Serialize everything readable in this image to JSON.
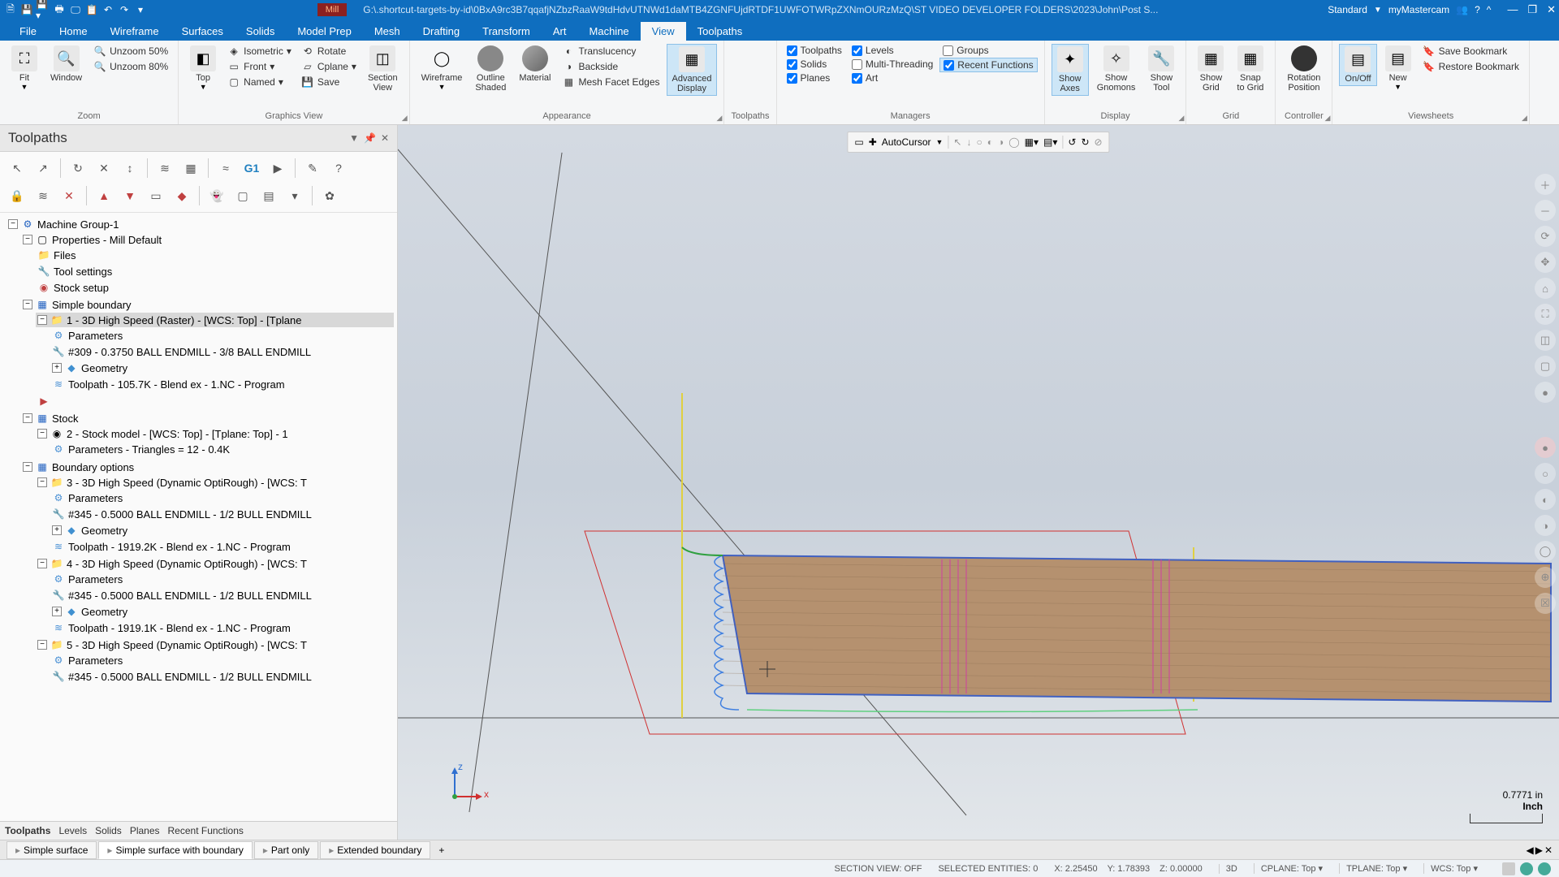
{
  "title": {
    "mode": "Mill",
    "path": "G:\\.shortcut-targets-by-id\\0BxA9rc3B7qqafjNZbzRaaW9tdHdvUTNWd1daMTB4ZGNFUjdRTDF1UWFOTWRpZXNmOURzMzQ\\ST VIDEO DEVELOPER FOLDERS\\2023\\John\\Post S..."
  },
  "qat_icons": [
    "new",
    "save",
    "save-as",
    "print",
    "print-preview",
    "paste",
    "undo",
    "redo",
    "customize"
  ],
  "titlebar_right": {
    "standard": "Standard",
    "mymc": "myMastercam"
  },
  "ribbon_tabs": [
    "File",
    "Home",
    "Wireframe",
    "Surfaces",
    "Solids",
    "Model Prep",
    "Mesh",
    "Drafting",
    "Transform",
    "Art",
    "Machine",
    "View",
    "Toolpaths"
  ],
  "active_ribbon_tab": "View",
  "ribbon": {
    "zoom": {
      "label": "Zoom",
      "fit": "Fit",
      "window": "Window",
      "unzoom50": "Unzoom 50%",
      "unzoom80": "Unzoom 80%"
    },
    "graphics": {
      "label": "Graphics View",
      "top": "Top",
      "iso": "Isometric",
      "front": "Front",
      "named": "Named",
      "rotate": "Rotate",
      "cplane": "Cplane",
      "save": "Save",
      "section": "Section\nView"
    },
    "appearance": {
      "label": "Appearance",
      "wireframe": "Wireframe",
      "outline": "Outline\nShaded",
      "material": "Material",
      "translucency": "Translucency",
      "backside": "Backside",
      "meshfacet": "Mesh Facet Edges",
      "advanced": "Advanced\nDisplay"
    },
    "toolpaths": {
      "label": "Toolpaths"
    },
    "managers": {
      "label": "Managers",
      "toolpaths": "Toolpaths",
      "solids": "Solids",
      "planes": "Planes",
      "levels": "Levels",
      "multi": "Multi-Threading",
      "art": "Art",
      "groups": "Groups",
      "recent": "Recent Functions"
    },
    "display": {
      "label": "Display",
      "showaxes": "Show\nAxes",
      "showgnomons": "Show\nGnomons",
      "showtool": "Show\nTool"
    },
    "grid": {
      "label": "Grid",
      "showgrid": "Show\nGrid",
      "snap": "Snap\nto Grid"
    },
    "controller": {
      "label": "Controller",
      "rotpos": "Rotation\nPosition"
    },
    "viewsheets": {
      "label": "Viewsheets",
      "onoff": "On/Off",
      "new": "New",
      "savebm": "Save Bookmark",
      "restorebm": "Restore Bookmark"
    }
  },
  "panel": {
    "title": "Toolpaths",
    "bottom_tabs": [
      "Toolpaths",
      "Levels",
      "Solids",
      "Planes",
      "Recent Functions"
    ],
    "active_bottom_tab": "Toolpaths"
  },
  "tree": {
    "machine_group": "Machine Group-1",
    "properties": "Properties - Mill Default",
    "files": "Files",
    "tool_settings": "Tool settings",
    "stock_setup": "Stock setup",
    "g1": "Simple boundary",
    "op1": "1 - 3D High Speed (Raster) - [WCS: Top] - [Tplane",
    "params": "Parameters",
    "tool309": "#309 - 0.3750 BALL ENDMILL - 3/8 BALL ENDMILL",
    "geometry": "Geometry",
    "tp1": "Toolpath - 105.7K - Blend ex - 1.NC - Program",
    "g2": "Stock",
    "op2": "2 - Stock model - [WCS: Top] - [Tplane: Top] - 1",
    "params2": "Parameters - Triangles =  12 - 0.4K",
    "g3": "Boundary options",
    "op3": "3 - 3D High Speed (Dynamic OptiRough) - [WCS: T",
    "tool345": "#345 - 0.5000 BALL ENDMILL - 1/2 BULL ENDMILL",
    "tp3": "Toolpath - 1919.2K - Blend ex - 1.NC - Program",
    "op4": "4 - 3D High Speed (Dynamic OptiRough) - [WCS: T",
    "tp4": "Toolpath - 1919.1K - Blend ex - 1.NC - Program",
    "op5": "5 - 3D High Speed (Dynamic OptiRough) - [WCS: T"
  },
  "viewport": {
    "autocursor": "AutoCursor",
    "scale_value": "0.7771 in",
    "scale_unit": "Inch",
    "gnomon_z": "z",
    "gnomon_x": "x"
  },
  "doc_tabs": [
    "Simple surface",
    "Simple surface with boundary",
    "Part only",
    "Extended boundary"
  ],
  "active_doc_tab": "Simple surface with boundary",
  "status": {
    "section": "SECTION VIEW: OFF",
    "selected": "SELECTED ENTITIES: 0",
    "x": "X: 2.25450",
    "y": "Y: 1.78393",
    "z": "Z: 0.00000",
    "mode3d": "3D",
    "cplane": "CPLANE: Top",
    "tplane": "TPLANE: Top",
    "wcs": "WCS: Top"
  }
}
